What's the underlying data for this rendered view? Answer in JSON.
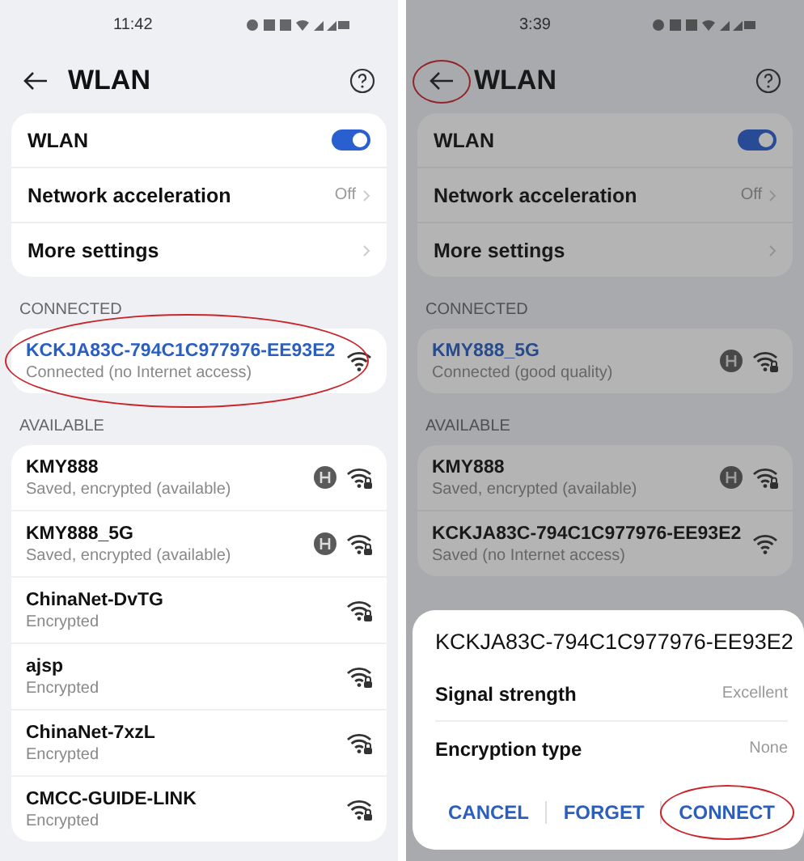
{
  "panels": [
    {
      "status_time": "11:42",
      "title": "WLAN",
      "back_circled": false,
      "settings": [
        {
          "kind": "toggle",
          "label": "WLAN",
          "on": true
        },
        {
          "kind": "link",
          "label": "Network acceleration",
          "value": "Off"
        },
        {
          "kind": "link",
          "label": "More settings"
        }
      ],
      "connected_header": "CONNECTED",
      "connected": {
        "name": "KCKJA83C-794C1C977976-EE93E2",
        "status": "Connected (no Internet access)",
        "saved": false,
        "locked": false,
        "circled": true
      },
      "available_header": "AVAILABLE",
      "networks": [
        {
          "name": "KMY888",
          "status": "Saved, encrypted (available)",
          "saved": true,
          "locked": true
        },
        {
          "name": "KMY888_5G",
          "status": "Saved, encrypted (available)",
          "saved": true,
          "locked": true
        },
        {
          "name": "ChinaNet-DvTG",
          "status": "Encrypted",
          "saved": false,
          "locked": true
        },
        {
          "name": "ajsp",
          "status": "Encrypted",
          "saved": false,
          "locked": true
        },
        {
          "name": "ChinaNet-7xzL",
          "status": "Encrypted",
          "saved": false,
          "locked": true
        },
        {
          "name": "CMCC-GUIDE-LINK",
          "status": "Encrypted",
          "saved": false,
          "locked": true
        }
      ]
    },
    {
      "status_time": "3:39",
      "title": "WLAN",
      "back_circled": true,
      "settings": [
        {
          "kind": "toggle",
          "label": "WLAN",
          "on": true
        },
        {
          "kind": "link",
          "label": "Network acceleration",
          "value": "Off"
        },
        {
          "kind": "link",
          "label": "More settings"
        }
      ],
      "connected_header": "CONNECTED",
      "connected": {
        "name": "KMY888_5G",
        "status": "Connected (good quality)",
        "saved": true,
        "locked": true,
        "circled": false
      },
      "available_header": "AVAILABLE",
      "networks": [
        {
          "name": "KMY888",
          "status": "Saved, encrypted (available)",
          "saved": true,
          "locked": true
        },
        {
          "name": "KCKJA83C-794C1C977976-EE93E2",
          "status": "Saved (no Internet access)",
          "saved": false,
          "locked": false
        }
      ],
      "dialog": {
        "title": "KCKJA83C-794C1C977976-EE93E2",
        "rows": [
          {
            "label": "Signal strength",
            "value": "Excellent"
          },
          {
            "label": "Encryption type",
            "value": "None"
          }
        ],
        "buttons": [
          {
            "label": "CANCEL",
            "circled": false
          },
          {
            "label": "FORGET",
            "circled": false
          },
          {
            "label": "CONNECT",
            "circled": true
          }
        ]
      }
    }
  ]
}
